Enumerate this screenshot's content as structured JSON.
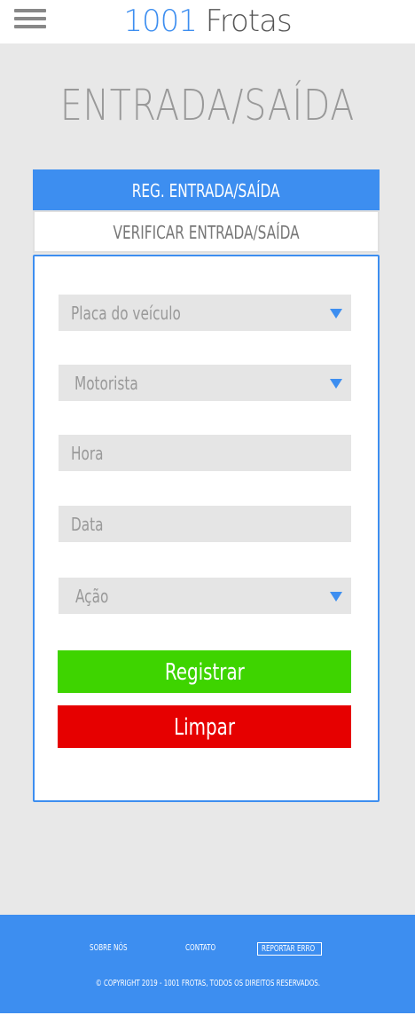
{
  "header": {
    "logo_number": "1001",
    "logo_name": "Frotas"
  },
  "page": {
    "title": "ENTRADA/SAÍDA"
  },
  "tabs": {
    "register": "REG. ENTRADA/SAÍDA",
    "verify": "VERIFICAR ENTRADA/SAÍDA"
  },
  "form": {
    "plate_label": "Placa do veículo",
    "driver_label": "Motorista",
    "time_placeholder": "Hora",
    "date_placeholder": "Data",
    "action_label": "Ação",
    "register_button": "Registrar",
    "clear_button": "Limpar"
  },
  "footer": {
    "about": "SOBRE NÓS",
    "contact": "CONTATO",
    "report": "REPORTAR ERRO",
    "copyright": "© COPYRIGHT 2019 - 1001 FROTAS, TODOS OS DIREITOS RESERVADOS."
  },
  "colors": {
    "accent": "#3d8ef0",
    "register": "#3ed400",
    "clear": "#e60000",
    "background": "#e8e8e8"
  },
  "icons": {
    "menu": "hamburger-menu-icon",
    "dropdown": "caret-down-icon"
  }
}
